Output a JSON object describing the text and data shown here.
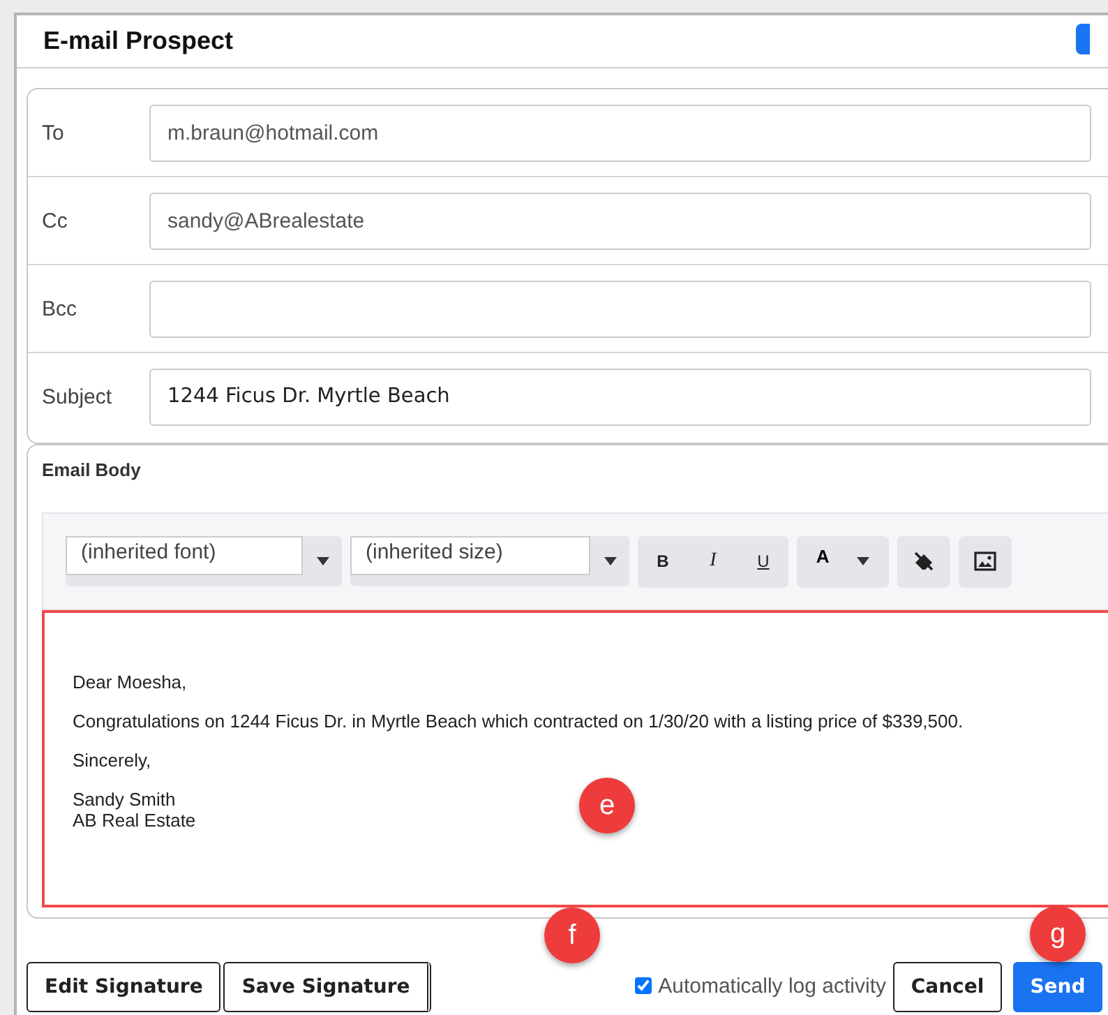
{
  "window": {
    "title": "E-mail Prospect"
  },
  "fields": [
    {
      "label": "To",
      "value": "m.braun@hotmail.com"
    },
    {
      "label": "Cc",
      "value": "sandy@ABrealestate"
    },
    {
      "label": "Bcc"
    },
    {
      "label": "Subject",
      "value": "1244 Ficus Dr. Myrtle Beach"
    }
  ],
  "email_body": {
    "heading": "Email Body",
    "toolbar": {
      "font": "(inherited font)",
      "size": "(inherited size)",
      "format_buttons": [
        "B",
        "I",
        "U"
      ],
      "color_button": "A"
    },
    "paragraphs": [
      "Dear Moesha,",
      "Congratulations on 1244 Ficus Dr. in Myrtle Beach which contracted on 1/30/20 with a listing price of $339,500.",
      "Sincerely,",
      "Sandy Smith\nAB Real Estate"
    ]
  },
  "footer": {
    "buttons": [
      "Edit Signature",
      "Save Signature"
    ],
    "auto_log": {
      "label": "Automatically log activity",
      "checked": true
    },
    "cancel": "Cancel",
    "send": "Send"
  },
  "callouts": [
    {
      "label": "e"
    },
    {
      "label": "f"
    },
    {
      "label": "g"
    }
  ]
}
